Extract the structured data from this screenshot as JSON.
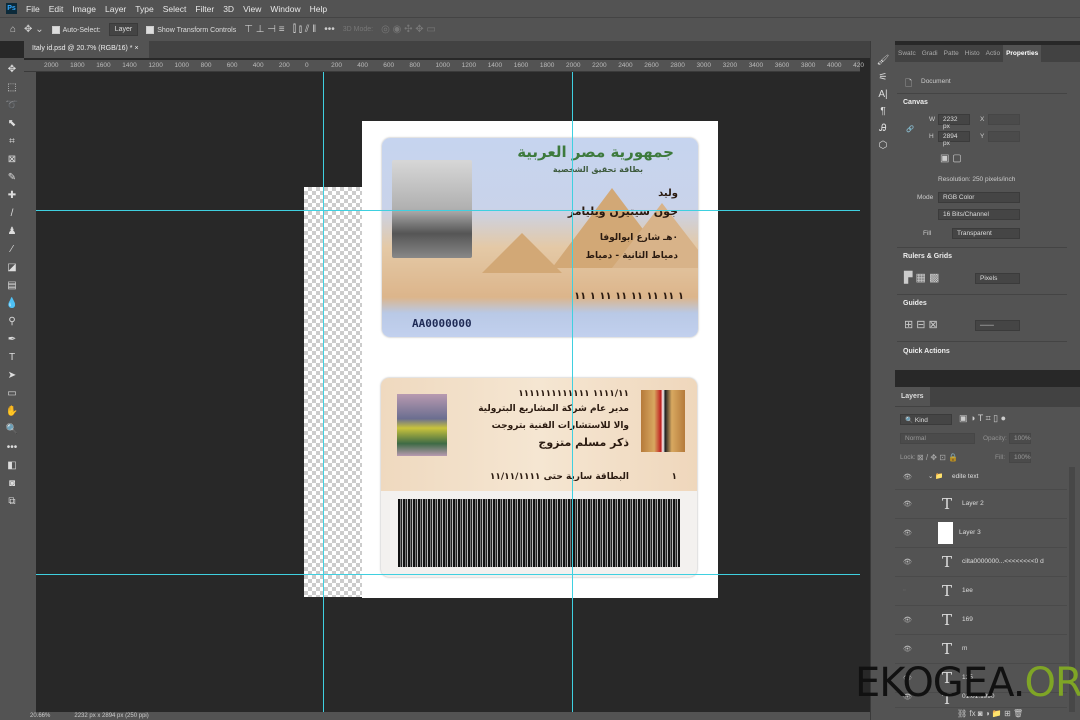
{
  "menu": [
    "File",
    "Edit",
    "Image",
    "Layer",
    "Type",
    "Select",
    "Filter",
    "3D",
    "View",
    "Window",
    "Help"
  ],
  "app_logo": "Ps",
  "options": {
    "auto_select": "Auto-Select:",
    "layer_select": "Layer",
    "show_transform": "Show Transform Controls",
    "mode_3d": "3D Mode:"
  },
  "doc_tab": "Italy id.psd @ 20.7% (RGB/16) *",
  "ruler_labels": [
    "2000",
    "1800",
    "1600",
    "1400",
    "1200",
    "1000",
    "800",
    "600",
    "400",
    "200",
    "0",
    "200",
    "400",
    "600",
    "800",
    "1000",
    "1200",
    "1400",
    "1600",
    "1800",
    "2000",
    "2200",
    "2400",
    "2600",
    "2800",
    "3000",
    "3200",
    "3400",
    "3600",
    "3800",
    "4000",
    "420"
  ],
  "status": {
    "zoom": "20.66%",
    "info": "2232 px x 2894 px (250 ppi)"
  },
  "card_front": {
    "title": "جمهورية مصر العربية",
    "subtitle": "بطاقة تحقيق الشخصية",
    "first_name": "وليد",
    "full_name": "جون سيتيزن ويليامز",
    "address1": "٠هـ شارع ابوالوفا",
    "address2": "دمياط الثانية - دمياط",
    "id_number": "١ ١١ ١١ ١١ ١١ ١١ ١ ١١",
    "serial": "AA0000000"
  },
  "card_back": {
    "line1": "١١١١/١١     ١١١١١١١١١١١١١",
    "job1": "مدير عام شركة المشاريع البترولية",
    "job2": "والا للاستشارات الفنية بتروجت",
    "status": "ذكر        مسلم        متزوج",
    "valid": "البطاقة سارية حتى ١١/١١/١١١١",
    "num": "١"
  },
  "properties": {
    "tabs": [
      "Swatc",
      "Gradi",
      "Patte",
      "Histo",
      "Actio",
      "Properties"
    ],
    "document_label": "Document",
    "canvas": "Canvas",
    "w_label": "W",
    "w": "2232 px",
    "h_label": "H",
    "h": "2894 px",
    "x_label": "X",
    "y_label": "Y",
    "resolution": "Resolution: 250 pixels/inch",
    "mode_label": "Mode",
    "mode": "RGB Color",
    "depth": "16 Bits/Channel",
    "fill_label": "Fill",
    "fill": "Transparent",
    "rulers": "Rulers & Grids",
    "units": "Pixels",
    "guides": "Guides",
    "quick_actions": "Quick Actions"
  },
  "layers": {
    "title": "Layers",
    "kind": "Kind",
    "blend": "Normal",
    "opacity_label": "Opacity:",
    "opacity": "100%",
    "lock_label": "Lock:",
    "fill_label": "Fill:",
    "fill": "100%",
    "items": [
      {
        "name": "edite text",
        "type": "group"
      },
      {
        "name": "Layer 2",
        "type": "text"
      },
      {
        "name": "Layer 3",
        "type": "image"
      },
      {
        "name": "cilta0000000...<<<<<<<<0 d",
        "type": "text"
      },
      {
        "name": "1ee",
        "type": "text"
      },
      {
        "name": "169",
        "type": "text"
      },
      {
        "name": "m",
        "type": "text"
      },
      {
        "name": "125",
        "type": "text"
      },
      {
        "name": "01.01.1990",
        "type": "text"
      }
    ]
  },
  "watermark": {
    "a": "EKOGEA.",
    "b": "ORG"
  },
  "colors": {
    "guide": "#3fd0e0",
    "panel": "#535353",
    "canvas": "#282828"
  }
}
